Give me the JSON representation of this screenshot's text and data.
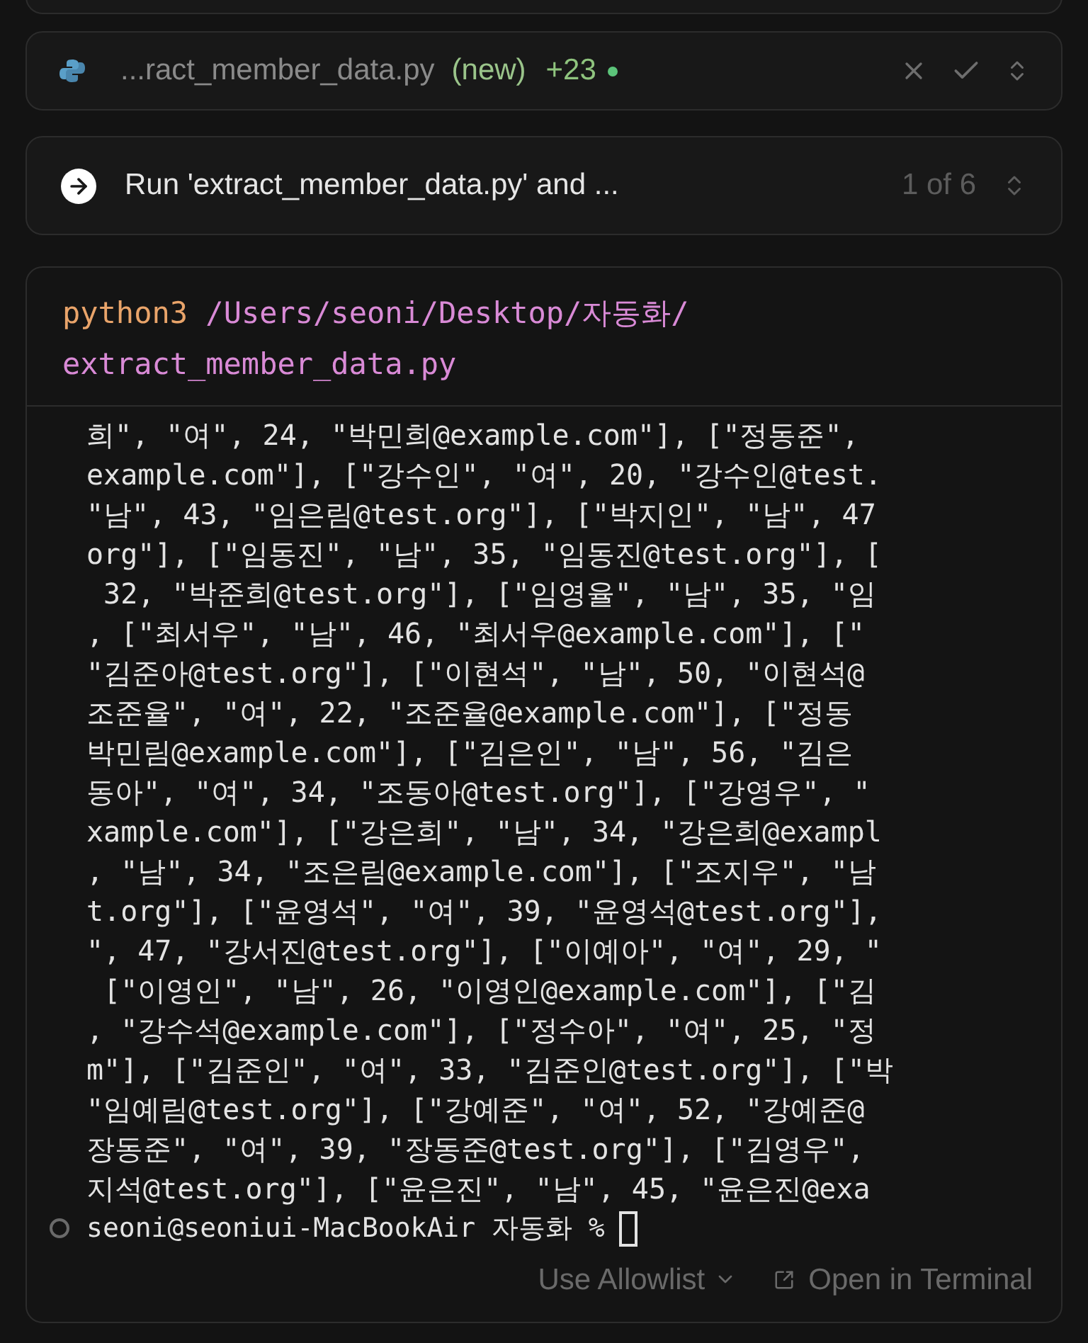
{
  "file_row": {
    "name": "...ract_member_data.py",
    "status": "(new)",
    "additions": "+23",
    "changed": true
  },
  "run_row": {
    "label": "Run 'extract_member_data.py' and ...",
    "counter": "1 of 6"
  },
  "terminal": {
    "command": {
      "program": "python3",
      "path": "/Users/seoni/Desktop/자동화/",
      "file": "extract_member_data.py"
    },
    "output": [
      "희\", \"여\", 24, \"박민희@example.com\"], [\"정동준\",",
      "example.com\"], [\"강수인\", \"여\", 20, \"강수인@test.",
      "\"남\", 43, \"임은림@test.org\"], [\"박지인\", \"남\", 47",
      "org\"], [\"임동진\", \"남\", 35, \"임동진@test.org\"], [",
      " 32, \"박준희@test.org\"], [\"임영율\", \"남\", 35, \"임",
      ", [\"최서우\", \"남\", 46, \"최서우@example.com\"], [\"",
      "\"김준아@test.org\"], [\"이현석\", \"남\", 50, \"이현석@",
      "조준율\", \"여\", 22, \"조준율@example.com\"], [\"정동",
      "박민림@example.com\"], [\"김은인\", \"남\", 56, \"김은",
      "동아\", \"여\", 34, \"조동아@test.org\"], [\"강영우\", \"",
      "xample.com\"], [\"강은희\", \"남\", 34, \"강은희@exampl",
      ", \"남\", 34, \"조은림@example.com\"], [\"조지우\", \"남",
      "t.org\"], [\"윤영석\", \"여\", 39, \"윤영석@test.org\"],",
      "\", 47, \"강서진@test.org\"], [\"이예아\", \"여\", 29, \"",
      " [\"이영인\", \"남\", 26, \"이영인@example.com\"], [\"김",
      ", \"강수석@example.com\"], [\"정수아\", \"여\", 25, \"정",
      "m\"], [\"김준인\", \"여\", 33, \"김준인@test.org\"], [\"박",
      "\"임예림@test.org\"], [\"강예준\", \"여\", 52, \"강예준@",
      "장동준\", \"여\", 39, \"장동준@test.org\"], [\"김영우\",",
      "지석@test.org\"], [\"윤은진\", \"남\", 45, \"윤은진@exa"
    ],
    "prompt": "seoni@seoniui-MacBookAir 자동화 %",
    "footer_buttons": [
      {
        "kind": "dropdown",
        "label": "Use Allowlist"
      },
      {
        "kind": "external",
        "label": "Open in Terminal"
      }
    ]
  }
}
